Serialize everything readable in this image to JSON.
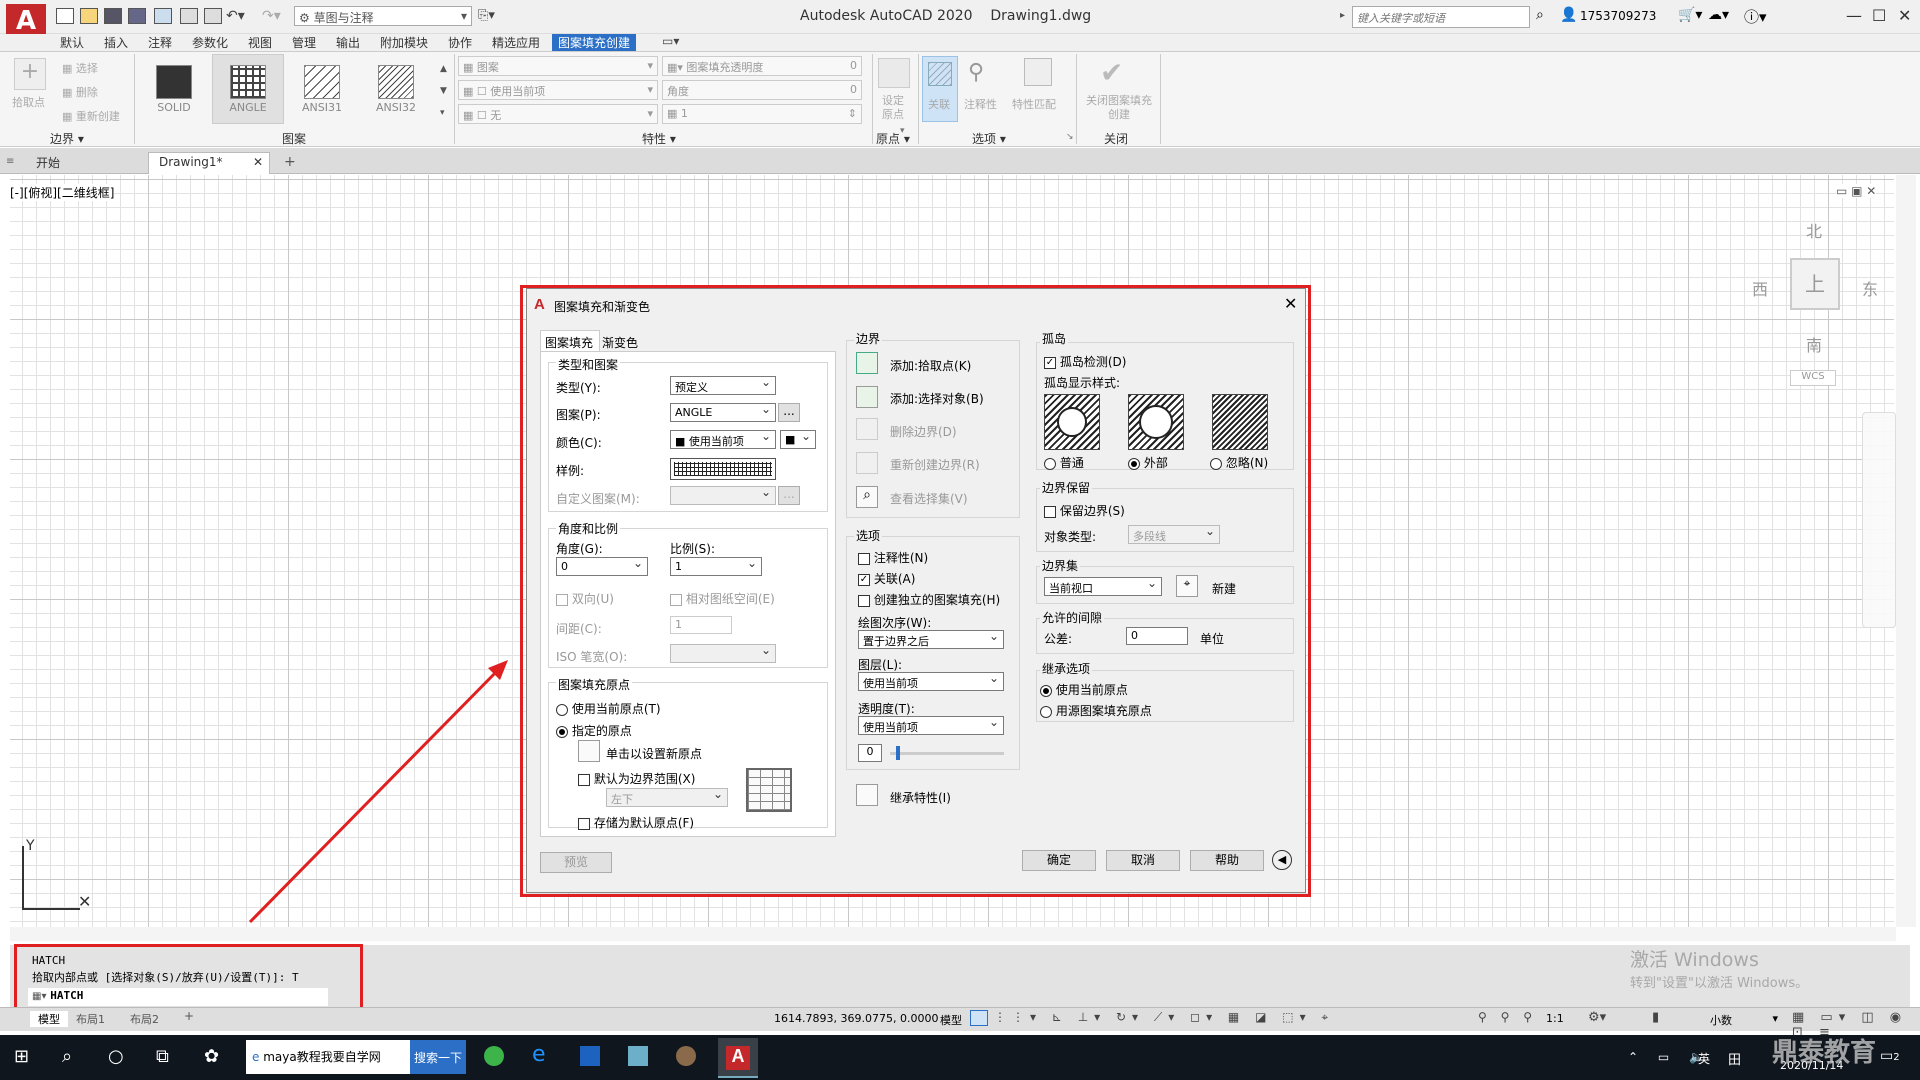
{
  "titlebar": {
    "workspace": "草图与注释",
    "title_app": "Autodesk AutoCAD 2020",
    "title_doc": "Drawing1.dwg",
    "search_placeholder": "键入关键字或短语",
    "user": "1753709273"
  },
  "menu_tabs": [
    "默认",
    "插入",
    "注释",
    "参数化",
    "视图",
    "管理",
    "输出",
    "附加模块",
    "协作",
    "精选应用",
    "图案填充创建"
  ],
  "ribbon": {
    "boundary": {
      "pick": "拾取点",
      "select": "选择",
      "remove": "删除",
      "recreate": "重新创建",
      "label": "边界 ▾"
    },
    "patterns": {
      "items": [
        "SOLID",
        "ANGLE",
        "ANSI31",
        "ANSI32"
      ],
      "label": "图案"
    },
    "properties": {
      "type": "图案",
      "transparency_label": "图案填充透明度",
      "transparency_value": "0",
      "color": "使用当前项",
      "angle_label": "角度",
      "angle_value": "0",
      "bg": "无",
      "scale": "1",
      "label": "特性 ▾"
    },
    "origin": {
      "set": "设定原点",
      "label": "原点 ▾"
    },
    "options": {
      "assoc": "关联",
      "annot": "注释性",
      "match": "特性匹配",
      "label": "选项 ▾"
    },
    "close": {
      "btn": "关闭图案填充创建",
      "label": "关闭"
    }
  },
  "doc_tabs": {
    "start": "开始",
    "drawing": "Drawing1*"
  },
  "viewport_label": "[-][俯视][二维线框]",
  "viewcube": {
    "n": "北",
    "s": "南",
    "e": "东",
    "w": "西",
    "top": "上",
    "wcs": "WCS"
  },
  "dialog": {
    "title": "图案填充和渐变色",
    "tabs": [
      "图案填充",
      "渐变色"
    ],
    "type_pattern": {
      "title": "类型和图案",
      "type_label": "类型(Y):",
      "type_value": "预定义",
      "pattern_label": "图案(P):",
      "pattern_value": "ANGLE",
      "color_label": "颜色(C):",
      "color_value": "使用当前项",
      "swatch_label": "样例:",
      "custom_label": "自定义图案(M):"
    },
    "angle_scale": {
      "title": "角度和比例",
      "angle_label": "角度(G):",
      "angle_value": "0",
      "scale_label": "比例(S):",
      "scale_value": "1",
      "double": "双向(U)",
      "relative": "相对图纸空间(E)",
      "spacing_label": "间距(C):",
      "spacing_value": "1",
      "iso_label": "ISO 笔宽(O):"
    },
    "origin": {
      "title": "图案填充原点",
      "use_current": "使用当前原点(T)",
      "specified": "指定的原点",
      "click_set": "单击以设置新原点",
      "default_extents": "默认为边界范围(X)",
      "extents_value": "左下",
      "store_default": "存储为默认原点(F)"
    },
    "boundaries": {
      "title": "边界",
      "add_pick": "添加:拾取点(K)",
      "add_select": "添加:选择对象(B)",
      "remove": "删除边界(D)",
      "recreate": "重新创建边界(R)",
      "view": "查看选择集(V)"
    },
    "options": {
      "title": "选项",
      "annotative": "注释性(N)",
      "associative": "关联(A)",
      "separate": "创建独立的图案填充(H)",
      "draw_order_label": "绘图次序(W):",
      "draw_order_value": "置于边界之后",
      "layer_label": "图层(L):",
      "layer_value": "使用当前项",
      "transparency_label": "透明度(T):",
      "transparency_value": "使用当前项",
      "slider_value": "0"
    },
    "inherit": "继承特性(I)",
    "islands": {
      "title": "孤岛",
      "detect": "孤岛检测(D)",
      "style_label": "孤岛显示样式:",
      "normal": "普通",
      "outer": "外部",
      "ignore": "忽略(N)"
    },
    "retention": {
      "title": "边界保留",
      "retain": "保留边界(S)",
      "object_type_label": "对象类型:",
      "object_type_value": "多段线"
    },
    "boundary_set": {
      "title": "边界集",
      "value": "当前视口",
      "new": "新建"
    },
    "gap": {
      "title": "允许的间隙",
      "tolerance_label": "公差:",
      "tolerance_value": "0",
      "unit": "单位"
    },
    "inherit_options": {
      "title": "继承选项",
      "use_current": "使用当前原点",
      "use_source": "用源图案填充原点"
    },
    "buttons": {
      "preview": "预览",
      "ok": "确定",
      "cancel": "取消",
      "help": "帮助"
    }
  },
  "command": {
    "line1": "HATCH",
    "line2": "拾取内部点或 [选择对象(S)/放弃(U)/设置(T)]: T",
    "input": "HATCH"
  },
  "layout_tabs": [
    "模型",
    "布局1",
    "布局2"
  ],
  "status": {
    "coords": "1614.7893, 369.0775, 0.0000",
    "model": "模型",
    "scale": "1:1",
    "units": "小数"
  },
  "watermark": {
    "line1": "激活 Windows",
    "line2": "转到\"设置\"以激活 Windows。"
  },
  "taskbar": {
    "browser": "maya教程我要自学网",
    "search_btn": "搜索一下",
    "ime": "英",
    "date": "2020/11/14",
    "notify": "2",
    "brand": "鼎泰教育"
  }
}
